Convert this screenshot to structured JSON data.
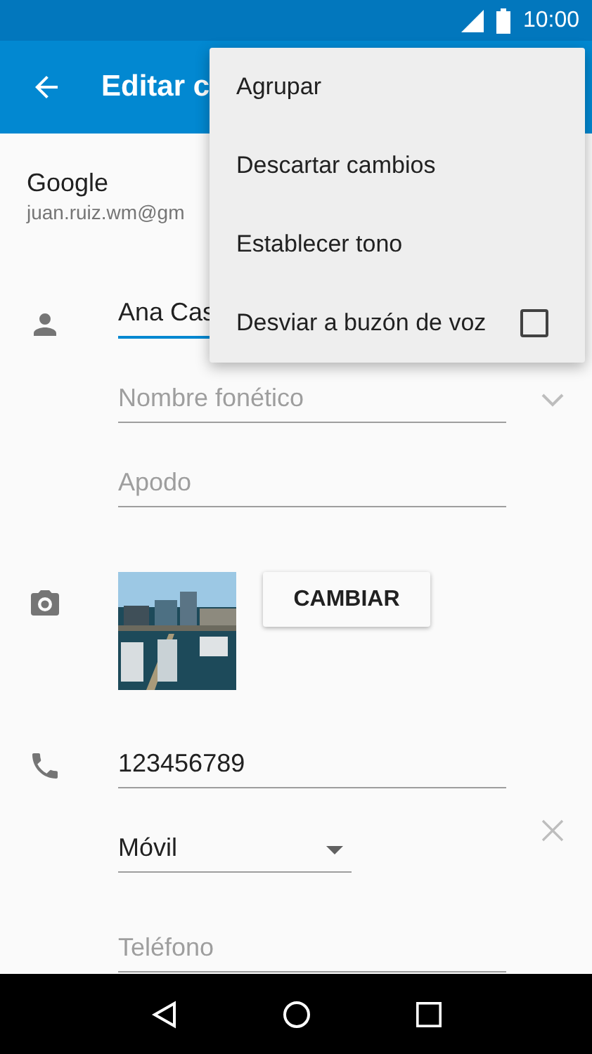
{
  "status_bar": {
    "time": "10:00"
  },
  "app_bar": {
    "title": "Editar c"
  },
  "menu": {
    "items": [
      {
        "label": "Agrupar",
        "kind": "action"
      },
      {
        "label": "Descartar cambios",
        "kind": "action"
      },
      {
        "label": "Establecer tono",
        "kind": "action"
      },
      {
        "label": "Desviar a buzón de voz",
        "kind": "checkbox",
        "checked": false
      }
    ]
  },
  "account": {
    "name": "Google",
    "email": "juan.ruiz.wm@gm"
  },
  "name_fields": [
    {
      "value": "Ana Cas",
      "focused": true
    },
    {
      "placeholder": "Nombre fonético",
      "focused": false
    },
    {
      "placeholder": "Apodo",
      "focused": false
    }
  ],
  "photo": {
    "kind": "picture",
    "button": "CAMBIAR"
  },
  "phone": {
    "number": "123456789",
    "type": "Móvil",
    "placeholder": "Teléfono"
  }
}
